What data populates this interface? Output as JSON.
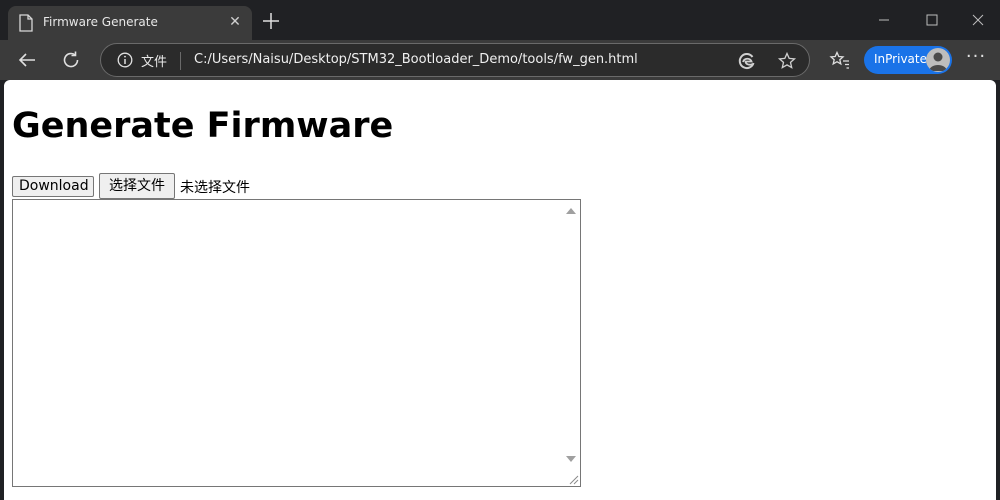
{
  "browser": {
    "tab": {
      "title": "Firmware Generate",
      "close_glyph": "✕"
    },
    "address_bar": {
      "file_label": "文件",
      "url": "C:/Users/Naisu/Desktop/STM32_Bootloader_Demo/tools/fw_gen.html"
    },
    "inprivate_label": "InPrivate",
    "more_glyph": "···",
    "icons": [
      "page-icon",
      "new-tab-icon",
      "minimize-icon",
      "maximize-icon",
      "close-icon",
      "back-arrow-icon",
      "reload-icon",
      "info-icon",
      "edge-icon",
      "star-icon",
      "favorites-icon",
      "avatar",
      "more-icon"
    ]
  },
  "page": {
    "heading": "Generate Firmware",
    "download_label": "Download",
    "choose_file_label": "选择文件",
    "no_file_text": "未选择文件",
    "textarea_value": ""
  },
  "colors": {
    "accent": "#1a73e8",
    "chrome_bg": "#202124",
    "toolbar_bg": "#3b3b3b"
  }
}
